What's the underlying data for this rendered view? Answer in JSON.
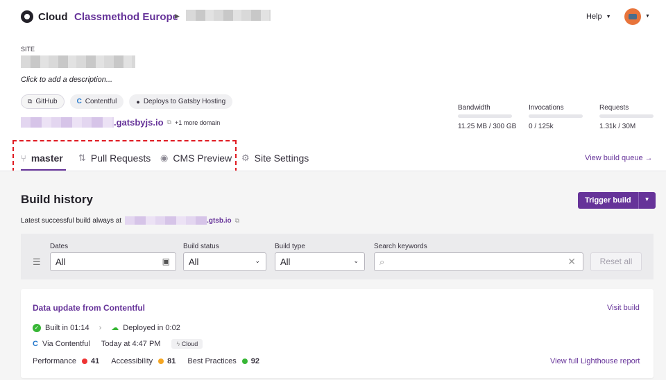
{
  "header": {
    "brand": "Cloud",
    "org": "Classmethod Europe",
    "help_label": "Help"
  },
  "site": {
    "section_label": "SITE",
    "description_placeholder": "Click to add a description...",
    "badges": [
      {
        "icon": "external-link-icon",
        "label": "GitHub"
      },
      {
        "icon": "contentful-icon",
        "label": "Contentful"
      },
      {
        "icon": "gatsby-icon",
        "label": "Deploys to Gatsby Hosting"
      }
    ],
    "domain_suffix": ".gatsbyjs.io",
    "more_domains": "+1 more domain"
  },
  "stats": [
    {
      "label": "Bandwidth",
      "value": "11.25 MB / 300 GB"
    },
    {
      "label": "Invocations",
      "value": "0 / 125k"
    },
    {
      "label": "Requests",
      "value": "1.31k / 30M"
    }
  ],
  "tabs": [
    {
      "label": "master",
      "active": true
    },
    {
      "label": "Pull Requests"
    },
    {
      "label": "CMS Preview"
    },
    {
      "label": "Site Settings"
    }
  ],
  "view_queue": "View build queue →",
  "build_history": {
    "title": "Build history",
    "trigger_label": "Trigger build",
    "latest_text": "Latest successful build always at",
    "latest_suffix": ".gtsb.io"
  },
  "filters": {
    "dates_label": "Dates",
    "dates_value": "All",
    "status_label": "Build status",
    "status_value": "All",
    "type_label": "Build type",
    "type_value": "All",
    "keywords_label": "Search keywords",
    "keywords_value": "",
    "reset_label": "Reset all"
  },
  "build": {
    "title": "Data update from Contentful",
    "visit_label": "Visit build",
    "built_in": "Built in 01:14",
    "deployed_in": "Deployed in 0:02",
    "via": "Via Contentful",
    "time": "Today at 4:47 PM",
    "cloud_tag": "Cloud",
    "perf_label": "Performance",
    "perf_value": "41",
    "access_label": "Accessibility",
    "access_value": "81",
    "bp_label": "Best Practices",
    "bp_value": "92",
    "lighthouse_label": "View full Lighthouse report"
  },
  "colors": {
    "accent": "#663399",
    "success": "#37b635",
    "fail": "#e33",
    "warn": "#f5a623"
  }
}
